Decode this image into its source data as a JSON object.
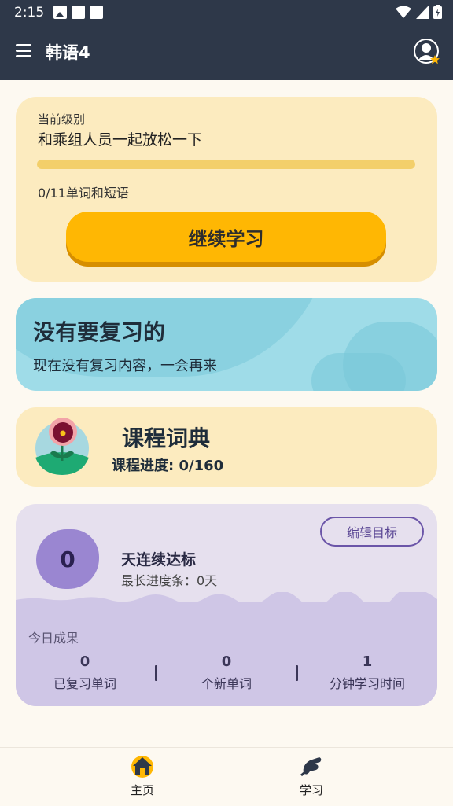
{
  "status_bar": {
    "time": "2:15"
  },
  "app_bar": {
    "title": "韩语4"
  },
  "level_card": {
    "label": "当前级别",
    "level_name": "和乘组人员一起放松一下",
    "progress": 0,
    "words_count": "0/11单词和短语",
    "continue_label": "继续学习"
  },
  "review_card": {
    "title": "没有要复习的",
    "subtitle": "现在没有复习内容，一会再来"
  },
  "dictionary_card": {
    "title": "课程词典",
    "progress_text": "课程进度: 0/160"
  },
  "streak_card": {
    "days": "0",
    "title": "天连续达标",
    "longest": "最长进度条：0天",
    "edit_goal_label": "编辑目标",
    "today_label": "今日成果",
    "stats": [
      {
        "value": "0",
        "label": "已复习单词"
      },
      {
        "value": "0",
        "label": "个新单词"
      },
      {
        "value": "1",
        "label": "分钟学习时间"
      }
    ]
  },
  "bottom_nav": {
    "items": [
      {
        "label": "主页",
        "icon": "home-icon",
        "active": true
      },
      {
        "label": "学习",
        "icon": "learn-icon",
        "active": false
      }
    ]
  },
  "colors": {
    "app_bar": "#2e3849",
    "accent_yellow": "#ffb703",
    "review_blue": "#9fdce8",
    "streak_purple": "#9a86d1"
  }
}
